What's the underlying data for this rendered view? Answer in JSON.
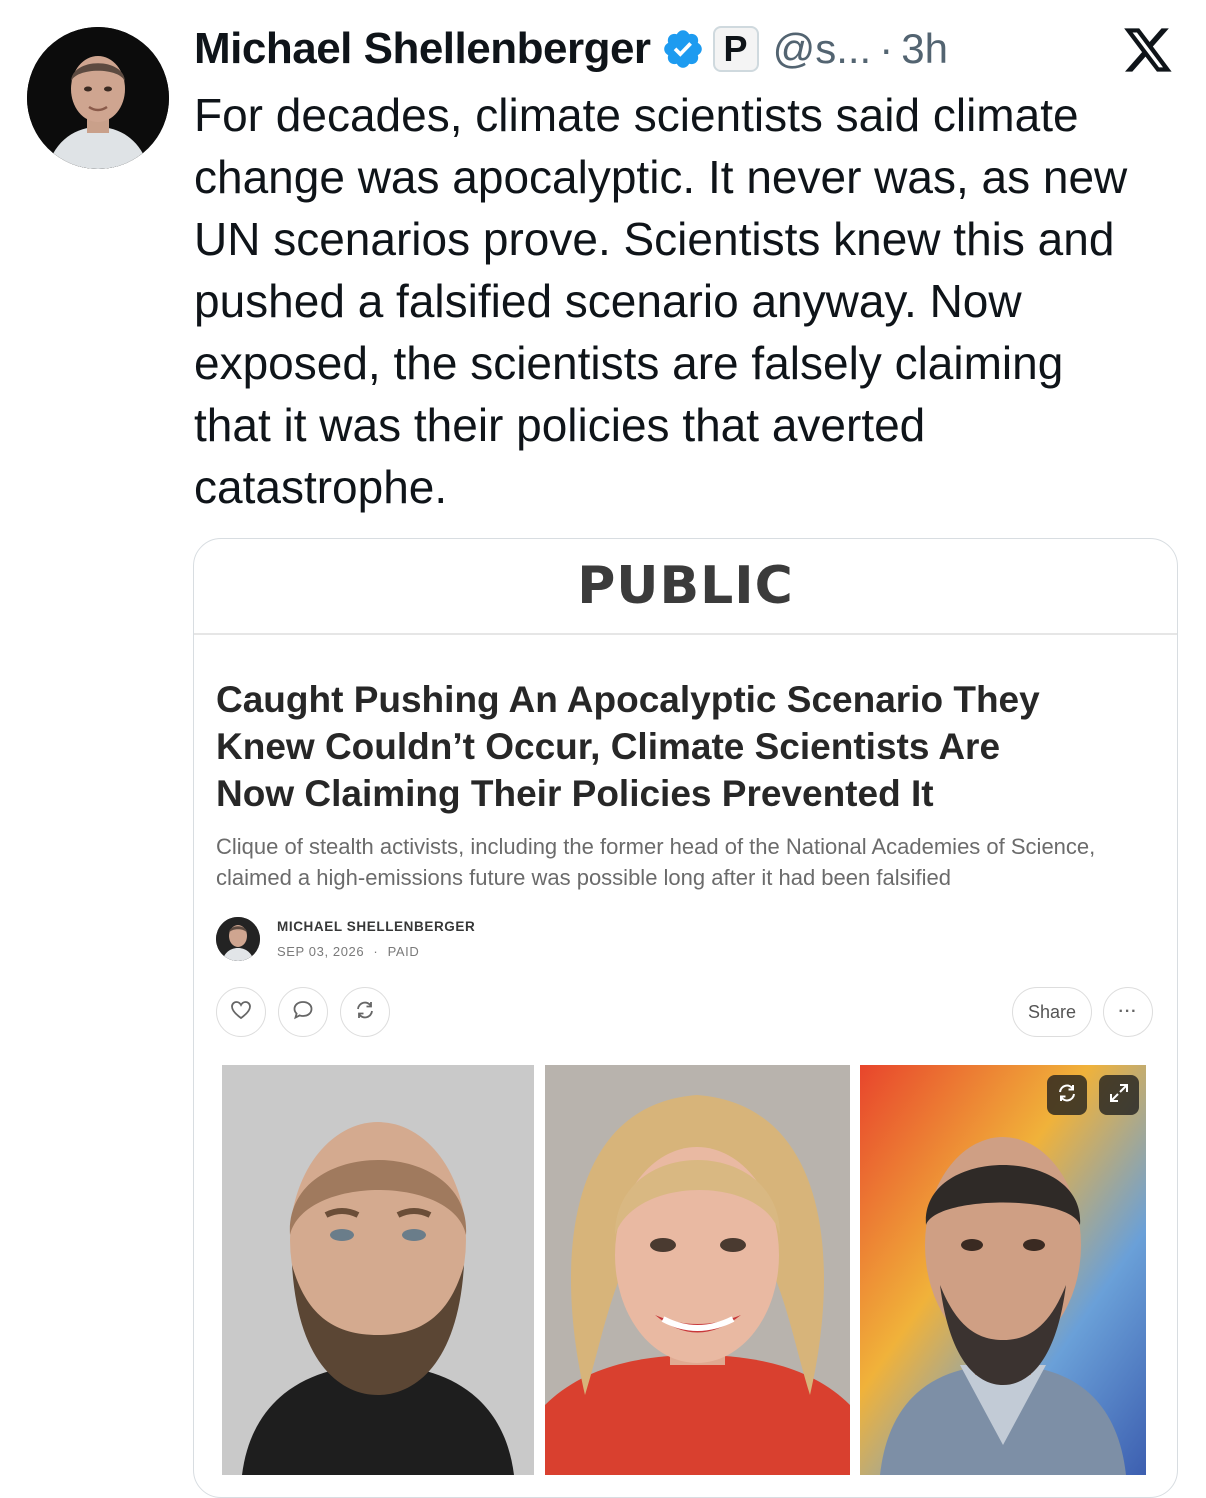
{
  "tweet": {
    "author_name": "Michael Shellenberger",
    "affiliate_badge": "P",
    "handle": "@s...",
    "separator": "·",
    "time": "3h",
    "text": "For decades, climate scientists said climate\nchange was apocalyptic. It never was, as new\nUN scenarios prove. Scientists knew this and\npushed a falsified scenario anyway. Now\nexposed, the scientists are falsely claiming\nthat it was their policies that averted\ncatastrophe."
  },
  "card": {
    "publication": "PUBLIC",
    "title": "Caught Pushing An Apocalyptic Scenario They\nKnew Couldn’t Occur, Climate Scientists Are\nNow Claiming Their Policies Prevented It",
    "subtitle": "Clique of stealth activists, including the former head of the National Academies of Science,\nclaimed a high-emissions future was possible long after it had been falsified",
    "byline": {
      "author": "MICHAEL SHELLENBERGER",
      "date": "SEP 03, 2026",
      "separator": "·",
      "access": "PAID"
    },
    "share_label": "Share",
    "more_label": "···"
  },
  "icons": {
    "verified": "verified-badge-icon",
    "x_logo": "x-logo-icon",
    "like": "heart-icon",
    "comment": "comment-icon",
    "restack": "restack-icon",
    "refresh": "refresh-icon",
    "expand": "expand-icon"
  },
  "colors": {
    "verified_blue": "#1d9bf0",
    "text_primary": "#0f1419",
    "text_secondary": "#536471"
  }
}
